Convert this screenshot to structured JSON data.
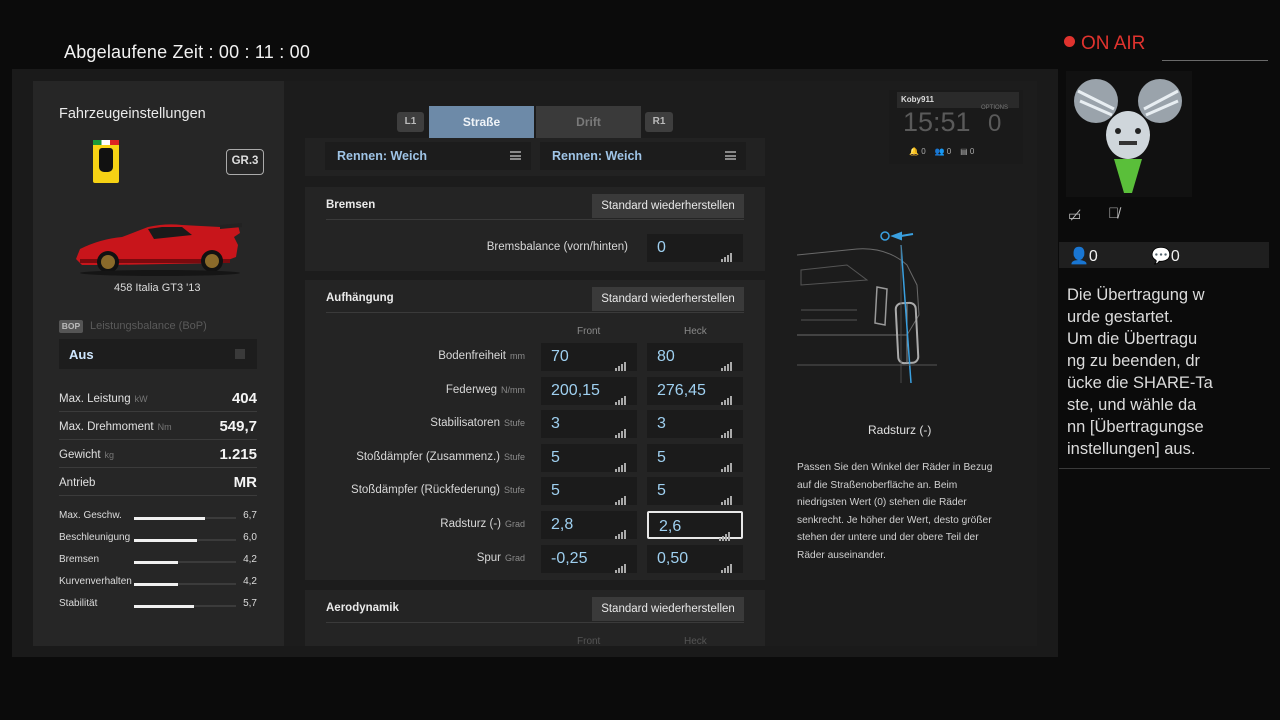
{
  "stream": {
    "elapsed_label": "Abgelaufene Zeit : 00 : 11 : 00",
    "on_air": "ON AIR",
    "viewers": "0",
    "comments": "0",
    "broadcast_message": [
      "Die Übertragung w",
      "urde gestartet.",
      "Um die Übertragu",
      "ng zu beenden, dr",
      "ücke die SHARE-Ta",
      "ste, und wähle da",
      "nn [Übertragungse",
      "instellungen] aus."
    ],
    "accent_color": "#e0332e"
  },
  "left_panel": {
    "title": "Fahrzeugeinstellungen",
    "group_badge": "GR.3",
    "car_name": "458 Italia GT3 '13",
    "bop_badge": "BOP",
    "bop_label": "Leistungsbalance (BoP)",
    "bop_value": "Aus",
    "stats": [
      {
        "label": "Max. Leistung",
        "unit": "kW",
        "value": "404"
      },
      {
        "label": "Max. Drehmoment",
        "unit": "Nm",
        "value": "549,7"
      },
      {
        "label": "Gewicht",
        "unit": "kg",
        "value": "1.215"
      },
      {
        "label": "Antrieb",
        "unit": "",
        "value": "MR"
      }
    ],
    "ratings": [
      {
        "label": "Max. Geschw.",
        "value": "6,7",
        "level": 0.7
      },
      {
        "label": "Beschleunigung",
        "value": "6,0",
        "level": 0.62
      },
      {
        "label": "Bremsen",
        "value": "4,2",
        "level": 0.43
      },
      {
        "label": "Kurvenverhalten",
        "value": "4,2",
        "level": 0.43
      },
      {
        "label": "Stabilität",
        "value": "5,7",
        "level": 0.59
      }
    ]
  },
  "tabs": {
    "left_shoulder": "L1",
    "right_shoulder": "R1",
    "items": [
      {
        "label": "Straße",
        "active": true
      },
      {
        "label": "Drift",
        "active": false
      }
    ]
  },
  "tyres": {
    "front": "Rennen: Weich",
    "rear": "Rennen: Weich"
  },
  "brakes": {
    "title": "Bremsen",
    "reset": "Standard wiederherstellen",
    "balance_label": "Bremsbalance (vorn/hinten)",
    "balance_value": "0"
  },
  "suspension": {
    "title": "Aufhängung",
    "reset": "Standard wiederherstellen",
    "col_front": "Front",
    "col_rear": "Heck",
    "rows": [
      {
        "label": "Bodenfreiheit",
        "unit": "mm",
        "front": "70",
        "rear": "80"
      },
      {
        "label": "Federweg",
        "unit": "N/mm",
        "front": "200,15",
        "rear": "276,45"
      },
      {
        "label": "Stabilisatoren",
        "unit": "Stufe",
        "front": "3",
        "rear": "3"
      },
      {
        "label": "Stoßdämpfer (Zusammenz.)",
        "unit": "Stufe",
        "front": "5",
        "rear": "5"
      },
      {
        "label": "Stoßdämpfer (Rückfederung)",
        "unit": "Stufe",
        "front": "5",
        "rear": "5"
      },
      {
        "label": "Radsturz (-)",
        "unit": "Grad",
        "front": "2,8",
        "rear": "2,6"
      },
      {
        "label": "Spur",
        "unit": "Grad",
        "front": "-0,25",
        "rear": "0,50"
      }
    ]
  },
  "aero": {
    "title": "Aerodynamik",
    "reset": "Standard wiederherstellen",
    "col_front": "Front",
    "col_rear": "Heck"
  },
  "hud": {
    "user": "Koby911",
    "time": "15:51",
    "options": "OPTIONS",
    "count": "0",
    "notifications": "0",
    "friends": "0",
    "messages": "0"
  },
  "info": {
    "title": "Radsturz (-)",
    "description": "Passen Sie den Winkel der Räder in Bezug auf die Straßenoberfläche an. Beim niedrigsten Wert (0) stehen die Räder senkrecht. Je höher der Wert, desto größer stehen der untere und der obere Teil der Räder auseinander."
  }
}
